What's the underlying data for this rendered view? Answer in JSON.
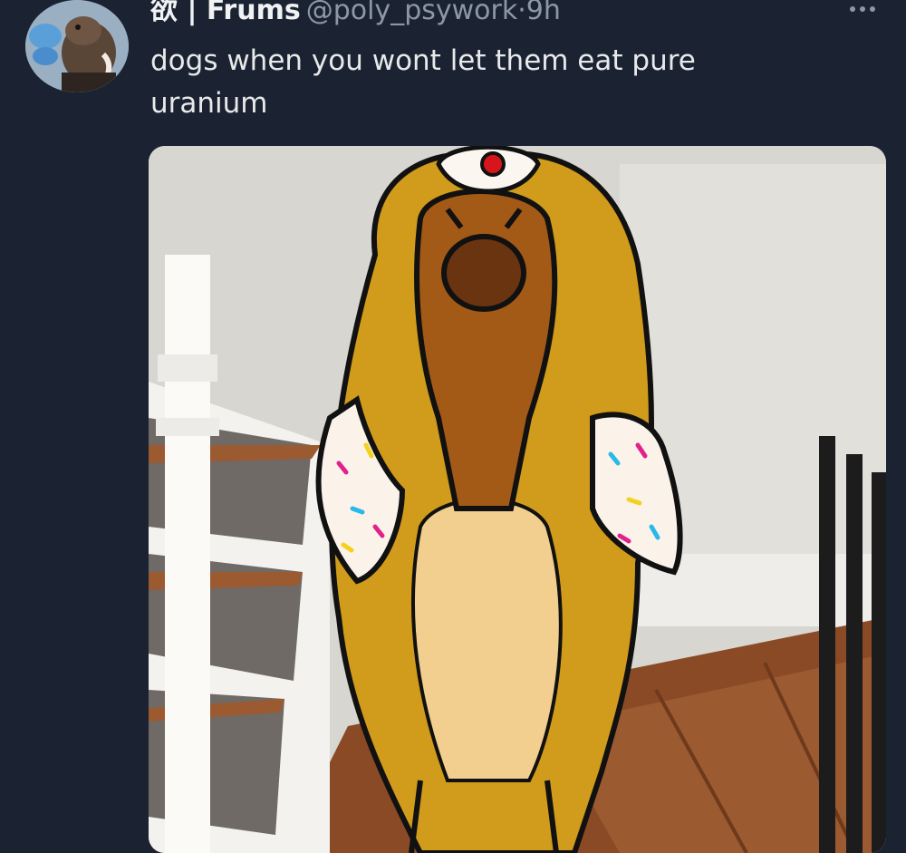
{
  "tweet": {
    "display_name": "欲 | Frums",
    "handle": "@poly_psywork",
    "separator": "·",
    "time": "9h",
    "text": "dogs when you wont let them eat pure uranium",
    "more_icon": "more-horizontal-icon"
  },
  "colors": {
    "background": "#1b2332",
    "text_primary": "#e7e9ea",
    "text_secondary": "#8b98a5"
  }
}
